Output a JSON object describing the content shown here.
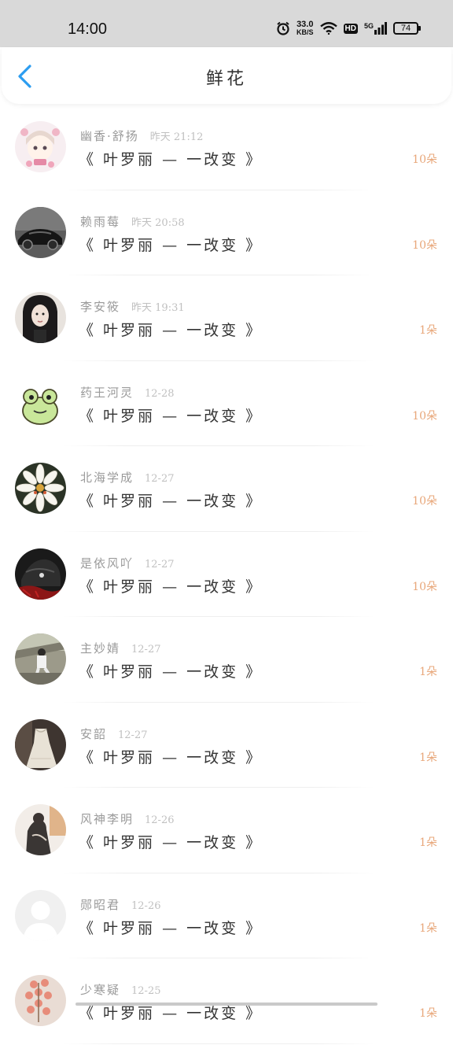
{
  "status_bar": {
    "time": "14:00",
    "net_speed_value": "33.0",
    "net_speed_unit": "KB/S",
    "hd": "HD",
    "network": "5G",
    "battery": "74"
  },
  "header": {
    "title": "鲜花"
  },
  "items": [
    {
      "name": "幽香·舒扬",
      "time": "昨天 21:12",
      "title": "《 叶罗丽 — 一改变 》",
      "count": "10朵",
      "avatar": "anime-girl"
    },
    {
      "name": "赖雨莓",
      "time": "昨天 20:58",
      "title": "《 叶罗丽 — 一改变 》",
      "count": "10朵",
      "avatar": "car"
    },
    {
      "name": "李安筱",
      "time": "昨天 19:31",
      "title": "《 叶罗丽 — 一改变 》",
      "count": "1朵",
      "avatar": "girl-portrait"
    },
    {
      "name": "药王河灵",
      "time": "12-28",
      "title": "《 叶罗丽 — 一改变 》",
      "count": "10朵",
      "avatar": "frog"
    },
    {
      "name": "北海学成",
      "time": "12-27",
      "title": "《 叶罗丽 — 一改变 》",
      "count": "10朵",
      "avatar": "white-flower"
    },
    {
      "name": "是依风吖",
      "time": "12-27",
      "title": "《 叶罗丽 — 一改变 》",
      "count": "10朵",
      "avatar": "dark-anime"
    },
    {
      "name": "主妙婧",
      "time": "12-27",
      "title": "《 叶罗丽 — 一改变 》",
      "count": "1朵",
      "avatar": "sitting-person"
    },
    {
      "name": "安韶",
      "time": "12-27",
      "title": "《 叶罗丽 — 一改变 》",
      "count": "1朵",
      "avatar": "dress"
    },
    {
      "name": "风神李明",
      "time": "12-26",
      "title": "《 叶罗丽 — 一改变 》",
      "count": "1朵",
      "avatar": "sketch-person"
    },
    {
      "name": "郧昭君",
      "time": "12-26",
      "title": "《 叶罗丽 — 一改变 》",
      "count": "1朵",
      "avatar": "default"
    },
    {
      "name": "少寒疑",
      "time": "12-25",
      "title": "《 叶罗丽 — 一改变 》",
      "count": "1朵",
      "avatar": "pink-flower"
    }
  ]
}
